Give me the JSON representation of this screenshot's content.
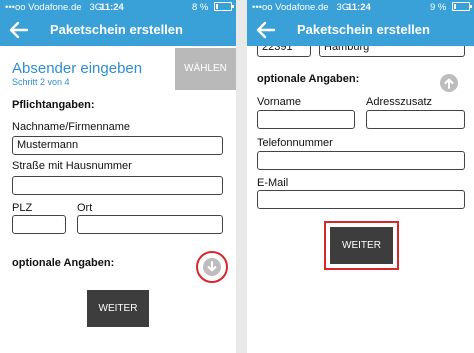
{
  "left": {
    "status": {
      "carrier": "•••oo Vodafone.de",
      "network": "3G",
      "time": "11:24",
      "battery": "8 %"
    },
    "appbar": {
      "title": "Paketschein erstellen"
    },
    "section": {
      "title": "Absender eingeben",
      "step": "Schritt 2 von 4",
      "choose_button": "WÄHLEN"
    },
    "form": {
      "required_heading": "Pflichtangaben:",
      "name_label": "Nachname/Firmenname",
      "name_value": "Mustermann",
      "street_label": "Straße mit Hausnummer",
      "street_value": "",
      "zip_label": "PLZ",
      "zip_value": "",
      "city_label": "Ort",
      "city_value": "",
      "optional_heading": "optionale Angaben:",
      "next_button": "WEITER"
    }
  },
  "right": {
    "status": {
      "carrier": "•••oo Vodafone.de",
      "network": "3G",
      "time": "11:24",
      "battery": "9 %"
    },
    "appbar": {
      "title": "Paketschein erstellen"
    },
    "form": {
      "zip_value_partial": "22391",
      "city_value_partial": "Hamburg",
      "optional_heading": "optionale Angaben:",
      "firstname_label": "Vorname",
      "firstname_value": "",
      "address_extra_label": "Adresszusatz",
      "address_extra_value": "",
      "phone_label": "Telefonnummer",
      "phone_value": "",
      "email_label": "E-Mail",
      "email_value": "",
      "next_button": "WEITER"
    }
  },
  "colors": {
    "accent": "#3aa0d8",
    "highlight": "#d8262d",
    "button_dark": "#3d3d3d"
  },
  "icons": {
    "back": "arrow-left-icon",
    "expand": "arrow-down-icon",
    "collapse": "arrow-up-icon"
  }
}
